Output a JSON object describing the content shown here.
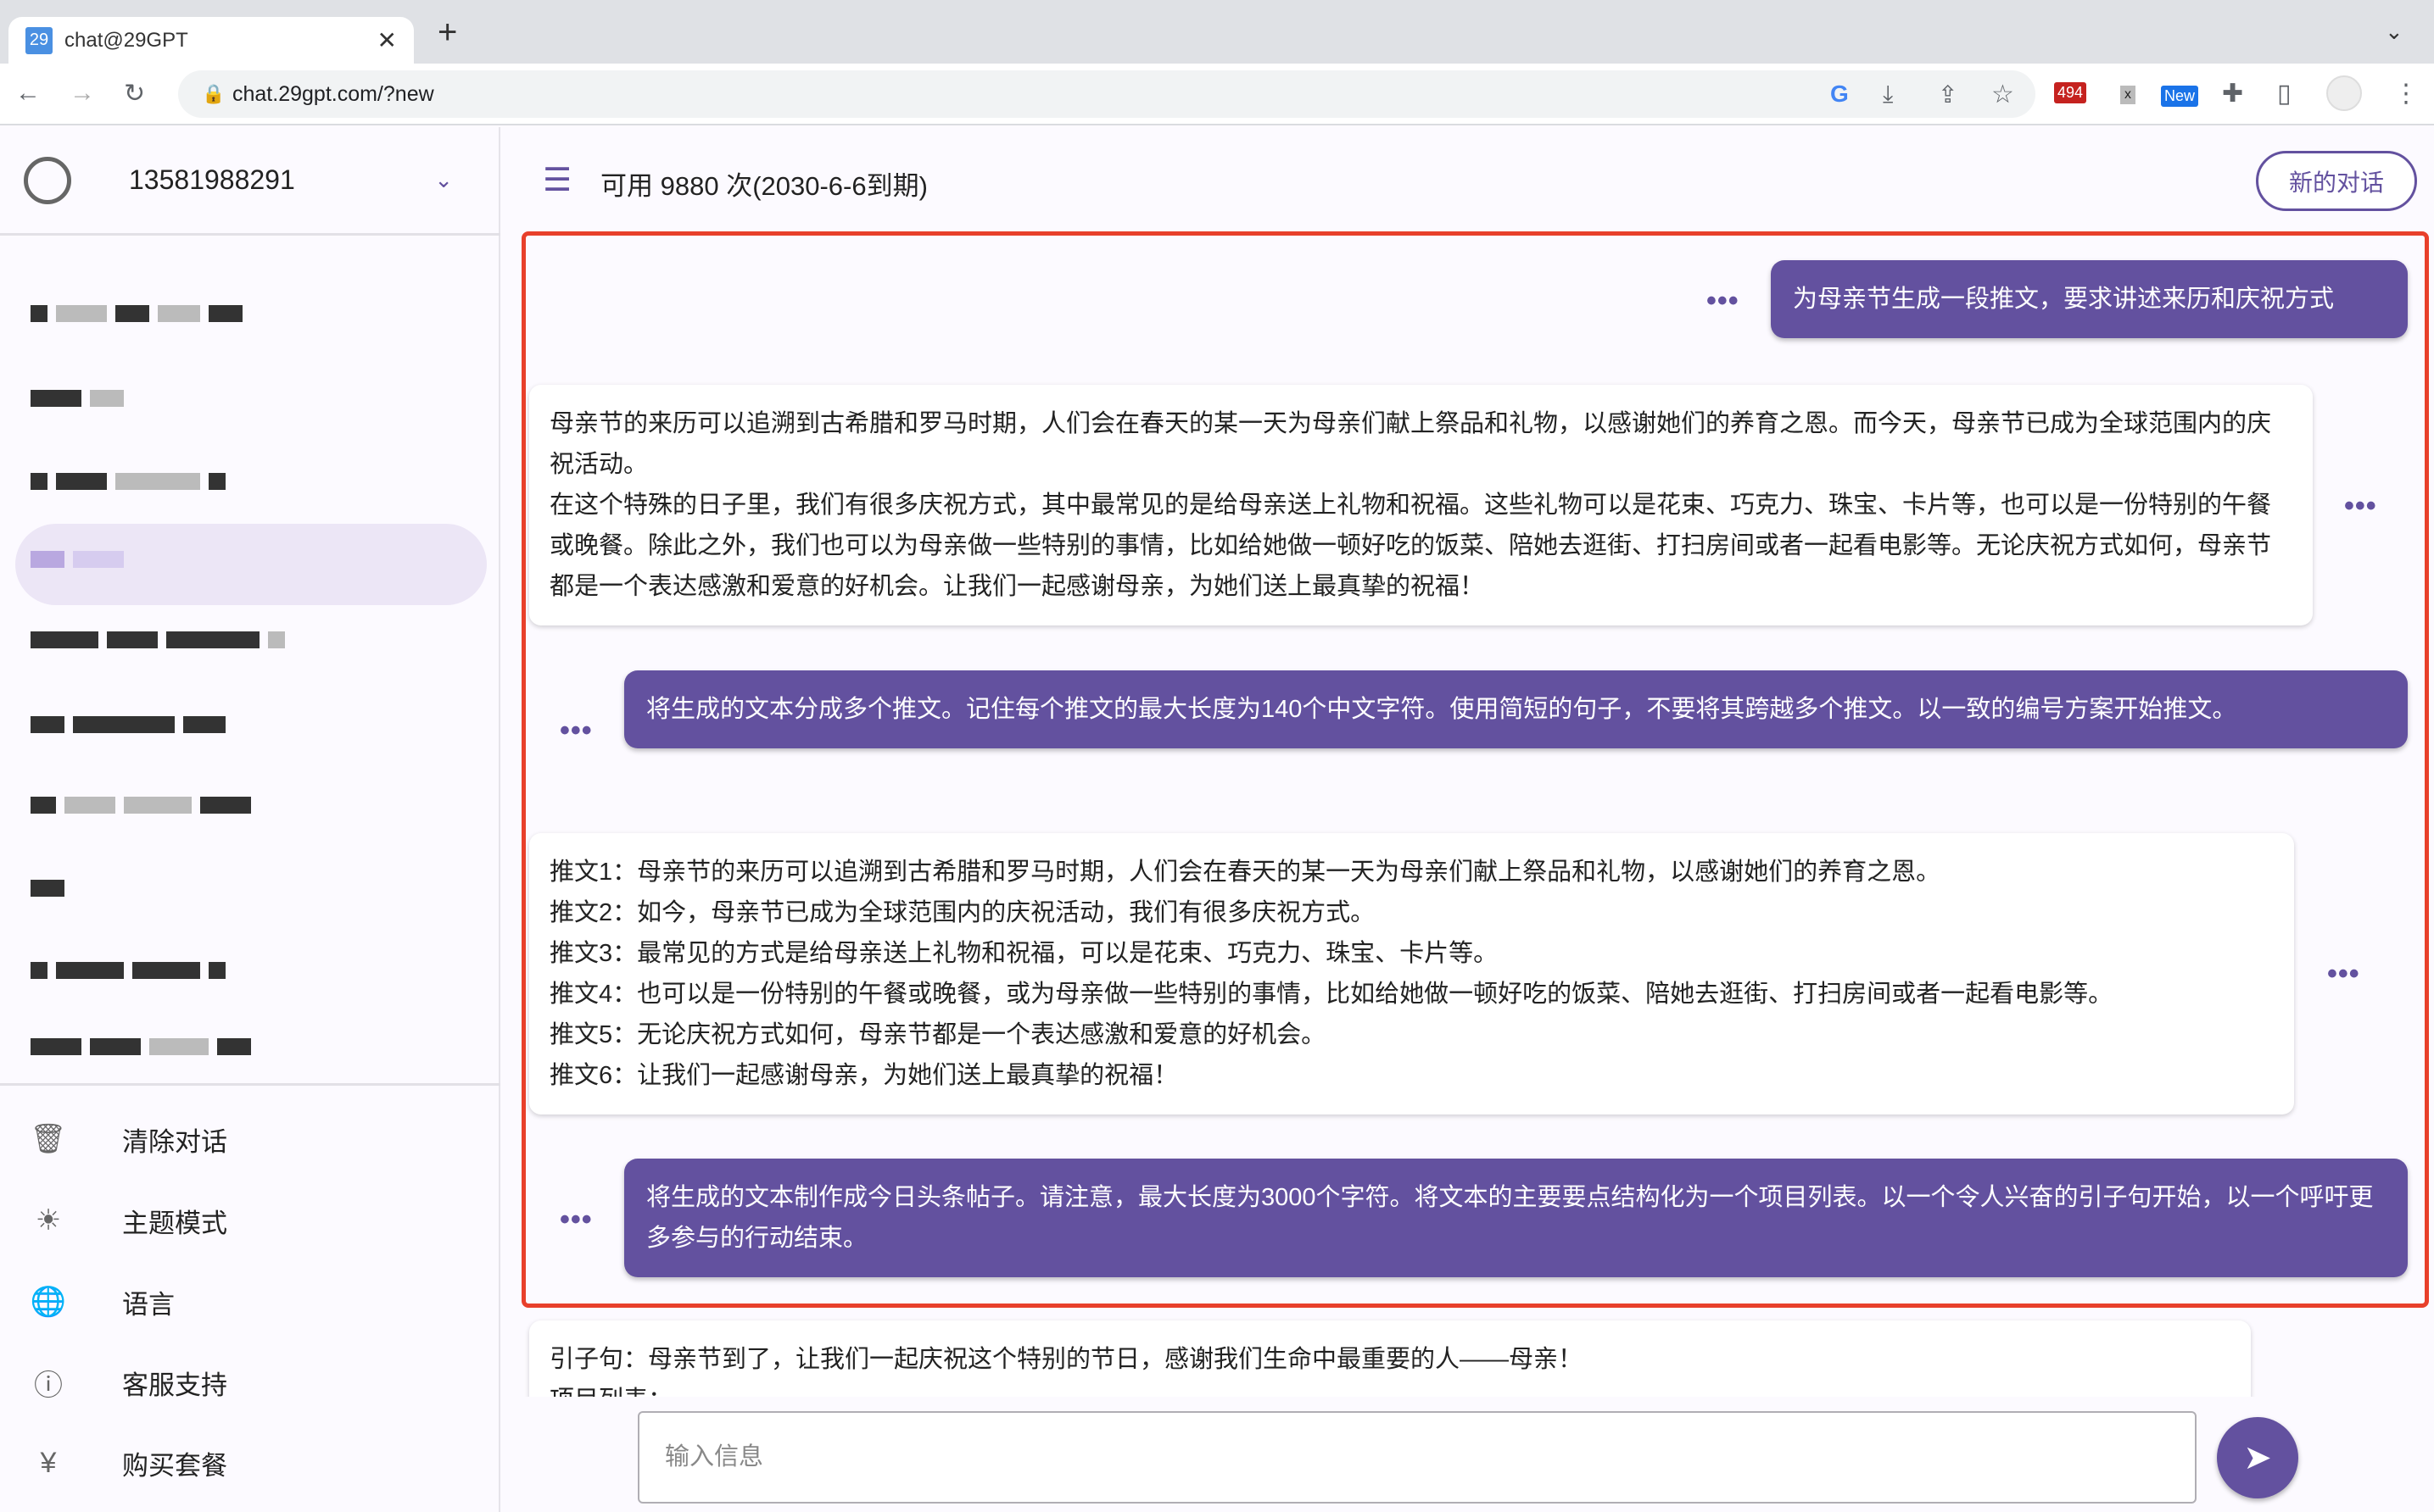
{
  "browser": {
    "tab_title": "chat@29GPT",
    "favicon": "29",
    "url": "chat.29gpt.com/?new",
    "badge_mail": "494",
    "badge_new": "New",
    "badge_x": "x"
  },
  "sidebar": {
    "account": "13581988291",
    "menu": [
      {
        "icon": "trash-icon",
        "label": "清除对话"
      },
      {
        "icon": "sun-icon",
        "label": "主题模式"
      },
      {
        "icon": "globe-icon",
        "label": "语言"
      },
      {
        "icon": "help-icon",
        "label": "客服支持"
      },
      {
        "icon": "yen-icon",
        "label": "购买套餐"
      }
    ]
  },
  "header": {
    "quota": "可用 9880 次(2030-6-6到期)",
    "new_chat": "新的对话"
  },
  "messages": [
    {
      "role": "user",
      "text": "为母亲节生成一段推文，要求讲述来历和庆祝方式"
    },
    {
      "role": "bot",
      "lines": [
        "母亲节的来历可以追溯到古希腊和罗马时期，人们会在春天的某一天为母亲们献上祭品和礼物，以感谢她们的养育之恩。而今天，母亲节已成为全球范围内的庆祝活动。",
        "在这个特殊的日子里，我们有很多庆祝方式，其中最常见的是给母亲送上礼物和祝福。这些礼物可以是花束、巧克力、珠宝、卡片等，也可以是一份特别的午餐或晚餐。除此之外，我们也可以为母亲做一些特别的事情，比如给她做一顿好吃的饭菜、陪她去逛街、打扫房间或者一起看电影等。无论庆祝方式如何，母亲节都是一个表达感激和爱意的好机会。让我们一起感谢母亲，为她们送上最真挚的祝福！"
      ]
    },
    {
      "role": "user",
      "text": "将生成的文本分成多个推文。记住每个推文的最大长度为140个中文字符。使用简短的句子，不要将其跨越多个推文。以一致的编号方案开始推文。"
    },
    {
      "role": "bot",
      "lines": [
        "推文1：母亲节的来历可以追溯到古希腊和罗马时期，人们会在春天的某一天为母亲们献上祭品和礼物，以感谢她们的养育之恩。",
        "推文2：如今，母亲节已成为全球范围内的庆祝活动，我们有很多庆祝方式。",
        "推文3：最常见的方式是给母亲送上礼物和祝福，可以是花束、巧克力、珠宝、卡片等。",
        "推文4：也可以是一份特别的午餐或晚餐，或为母亲做一些特别的事情，比如给她做一顿好吃的饭菜、陪她去逛街、打扫房间或者一起看电影等。",
        "推文5：无论庆祝方式如何，母亲节都是一个表达感激和爱意的好机会。",
        "推文6：让我们一起感谢母亲，为她们送上最真挚的祝福！"
      ]
    },
    {
      "role": "user",
      "text": "将生成的文本制作成今日头条帖子。请注意，最大长度为3000个字符。将文本的主要要点结构化为一个项目列表。以一个令人兴奋的引子句开始，以一个呼吁更多参与的行动结束。"
    },
    {
      "role": "bot",
      "lines": [
        "引子句：母亲节到了，让我们一起庆祝这个特别的节日，感谢我们生命中最重要的人——母亲！",
        "项目列表："
      ]
    }
  ],
  "dots": "•••",
  "input": {
    "placeholder": "输入信息",
    "value": ""
  },
  "colors": {
    "accent": "#63519f",
    "highlight_border": "#e8402b"
  }
}
